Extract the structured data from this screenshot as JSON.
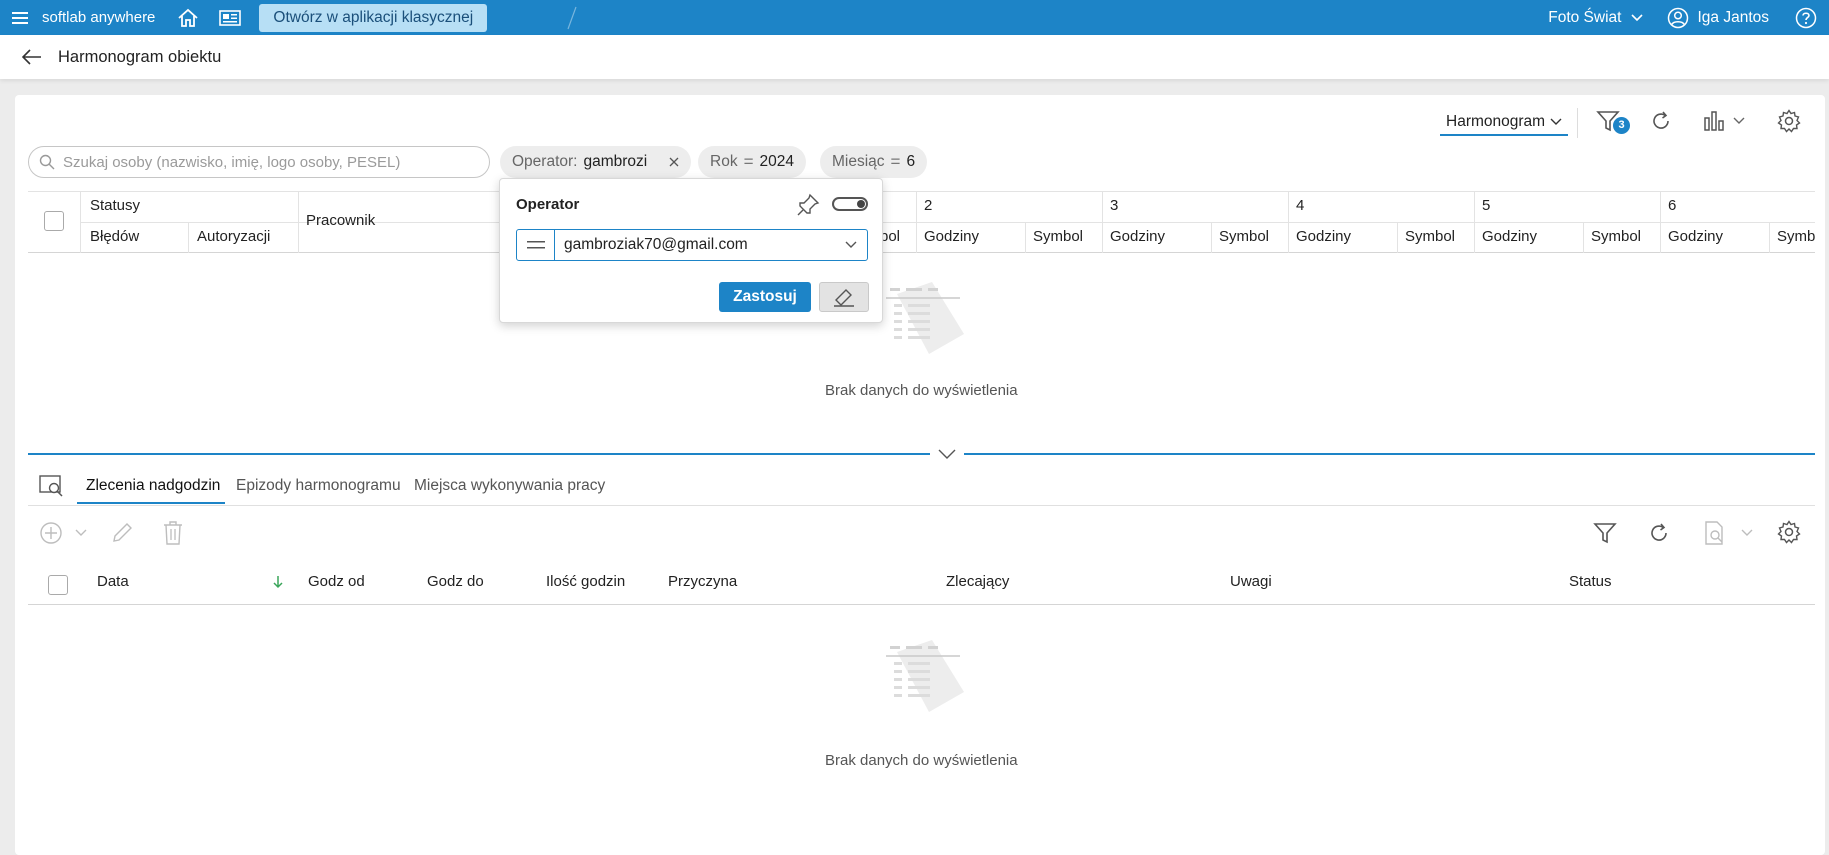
{
  "topbar": {
    "brand": "softlab anywhere",
    "open_classic": "Otwórz w aplikacji klasycznej",
    "company": "Foto Świat",
    "user": "Iga Jantos"
  },
  "page": {
    "title": "Harmonogram obiektu"
  },
  "toolbar": {
    "view": "Harmonogram",
    "filter_count": "3"
  },
  "search": {
    "placeholder": "Szukaj osoby (nazwisko, imię, logo osoby, PESEL)"
  },
  "chips": [
    {
      "label": "Operator:",
      "value": "gambrozi"
    },
    {
      "label": "Rok",
      "value": "2024"
    },
    {
      "label": "Miesiąc",
      "value": "6"
    }
  ],
  "grid": {
    "statusy": "Statusy",
    "bledow": "Błędów",
    "autoryzacji": "Autoryzacji",
    "pracownik": "Pracownik",
    "partial_symbol": "bol",
    "days": [
      "2",
      "3",
      "4",
      "5",
      "6"
    ],
    "godziny": "Godziny",
    "symbol": "Symbol",
    "cut_symbol": "Symb",
    "empty": "Brak danych do wyświetlenia"
  },
  "tabs": [
    "Zlecenia nadgodzin",
    "Epizody harmonogramu",
    "Miejsca wykonywania pracy"
  ],
  "lower_grid": {
    "columns": [
      "Data",
      "Godz od",
      "Godz do",
      "Ilość godzin",
      "Przyczyna",
      "Zlecający",
      "Uwagi",
      "Status"
    ],
    "empty": "Brak danych do wyświetlenia"
  },
  "popover": {
    "title": "Operator",
    "value": "gambroziak70@gmail.com",
    "apply": "Zastosuj"
  }
}
